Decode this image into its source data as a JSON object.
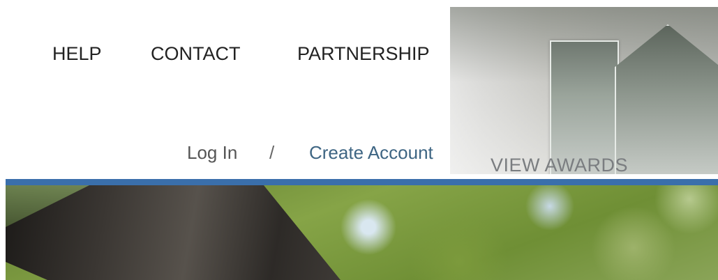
{
  "nav": {
    "help": "HELP",
    "contact": "CONTACT",
    "partnership": "PARTNERSHIP"
  },
  "account": {
    "login": "Log In",
    "separator": "/",
    "create": "Create Account"
  },
  "awards": {
    "label": "VIEW AWARDS"
  },
  "colors": {
    "accent_bar": "#3a6fab",
    "link": "#3e6583"
  }
}
